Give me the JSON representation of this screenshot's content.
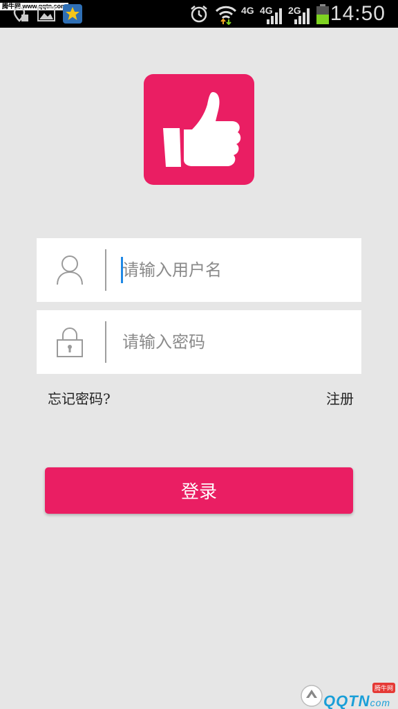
{
  "status_bar": {
    "watermark": "腾牛网 www.qqtn.com",
    "network_1": "4G",
    "network_2": "4G",
    "network_3": "2G",
    "time": "14:50"
  },
  "login_form": {
    "username_placeholder": "请输入用户名",
    "password_placeholder": "请输入密码"
  },
  "links": {
    "forgot_password": "忘记密码?",
    "register": "注册"
  },
  "login_button": "登录",
  "watermark_bottom": {
    "brand": "QQTN",
    "suffix": "com",
    "tag": "腾牛网"
  },
  "colors": {
    "accent": "#ea1e63",
    "background": "#e6e6e6",
    "caret": "#1e88e5"
  },
  "icons": [
    "location-icon",
    "image-icon",
    "star-app-icon",
    "alarm-icon",
    "wifi-icon",
    "signal-icon",
    "battery-icon",
    "thumbs-up-icon",
    "user-icon",
    "lock-icon"
  ]
}
